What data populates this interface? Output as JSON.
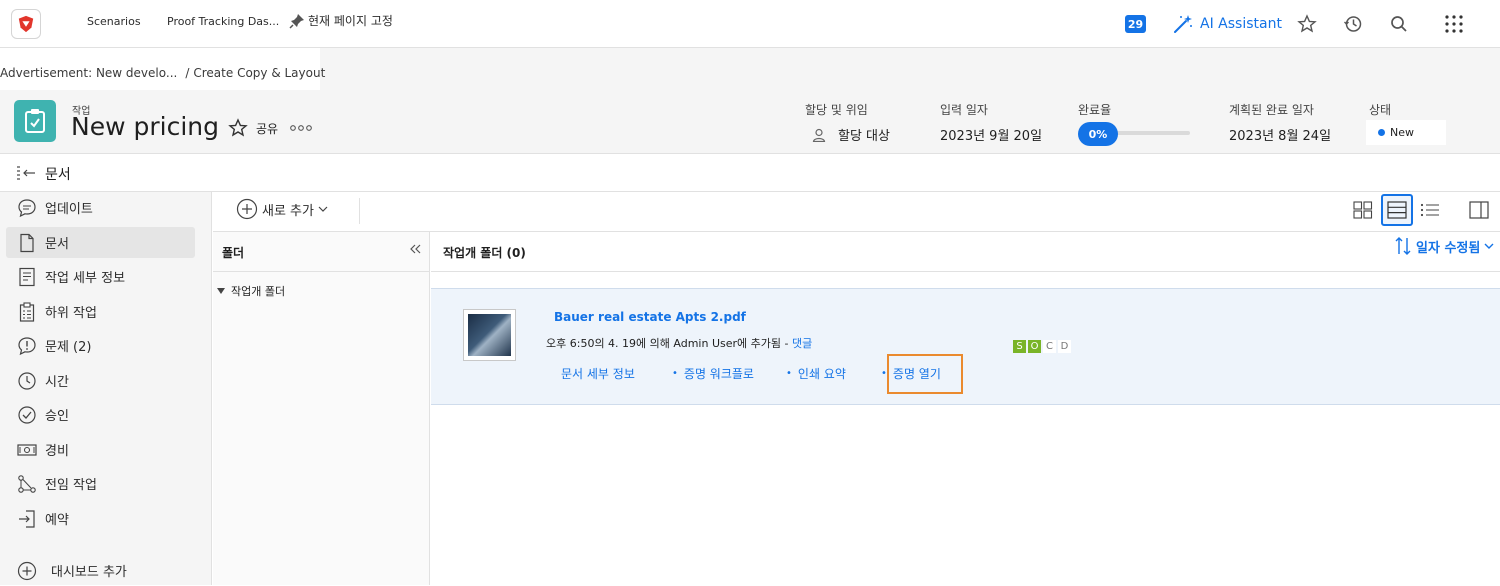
{
  "topbar": {
    "nav_items": [
      "Scenarios",
      "Proof Tracking Das..."
    ],
    "pin_label": "현재 페이지 고정",
    "notification_count": "29",
    "ai_label": "AI Assistant"
  },
  "breadcrumb": {
    "parent": "Advertisement: New develo...",
    "current": "Create Copy & Layout"
  },
  "header": {
    "object_kind": "작업",
    "title": "New pricing",
    "share_label": "공유",
    "assign_label": "할당 및 위임",
    "assign_value": "할당 대상",
    "entry_date_label": "입력 일자",
    "entry_date_value": "2023년 9월 20일",
    "completion_label": "완료율",
    "completion_value": "0%",
    "completion_fraction": 0,
    "planned_label": "계획된 완료 일자",
    "planned_value": "2023년 8월 24일",
    "status_label": "상태",
    "status_value": "New"
  },
  "section_title": "문서",
  "sidebar": {
    "items": [
      {
        "label": "업데이트",
        "icon": "chat-icon"
      },
      {
        "label": "문서",
        "icon": "document-icon"
      },
      {
        "label": "작업 세부 정보",
        "icon": "details-icon"
      },
      {
        "label": "하위 작업",
        "icon": "subtask-icon"
      },
      {
        "label": "문제 (2)",
        "icon": "issue-icon"
      },
      {
        "label": "시간",
        "icon": "clock-icon"
      },
      {
        "label": "승인",
        "icon": "approval-icon"
      },
      {
        "label": "경비",
        "icon": "money-icon"
      },
      {
        "label": "전임 작업",
        "icon": "predecessor-icon"
      },
      {
        "label": "예약",
        "icon": "booking-icon"
      }
    ],
    "add_dashboard": "대시보드 추가"
  },
  "toolbar": {
    "add_new": "새로 추가"
  },
  "folders": {
    "header": "폴더",
    "item": "작업개 폴더"
  },
  "content": {
    "header": "작업개 폴더 (0)",
    "sort_label": "일자 수정됨",
    "document": {
      "name": "Bauer real estate Apts 2.pdf",
      "meta": "오후 6:50의 4. 19에 의해 Admin User에 추가됨 - ",
      "comment_link": "댓글",
      "actions": [
        "문서 세부 정보",
        "증명 워크플로",
        "인쇄 요약",
        "증명 열기"
      ],
      "status_flags": [
        "S",
        "O",
        "C",
        "D"
      ]
    }
  },
  "colors": {
    "accent": "#1473e6",
    "task_icon": "#3fb3b0",
    "highlight_box": "#ea8a2e",
    "flag_on": "#7ab428"
  }
}
